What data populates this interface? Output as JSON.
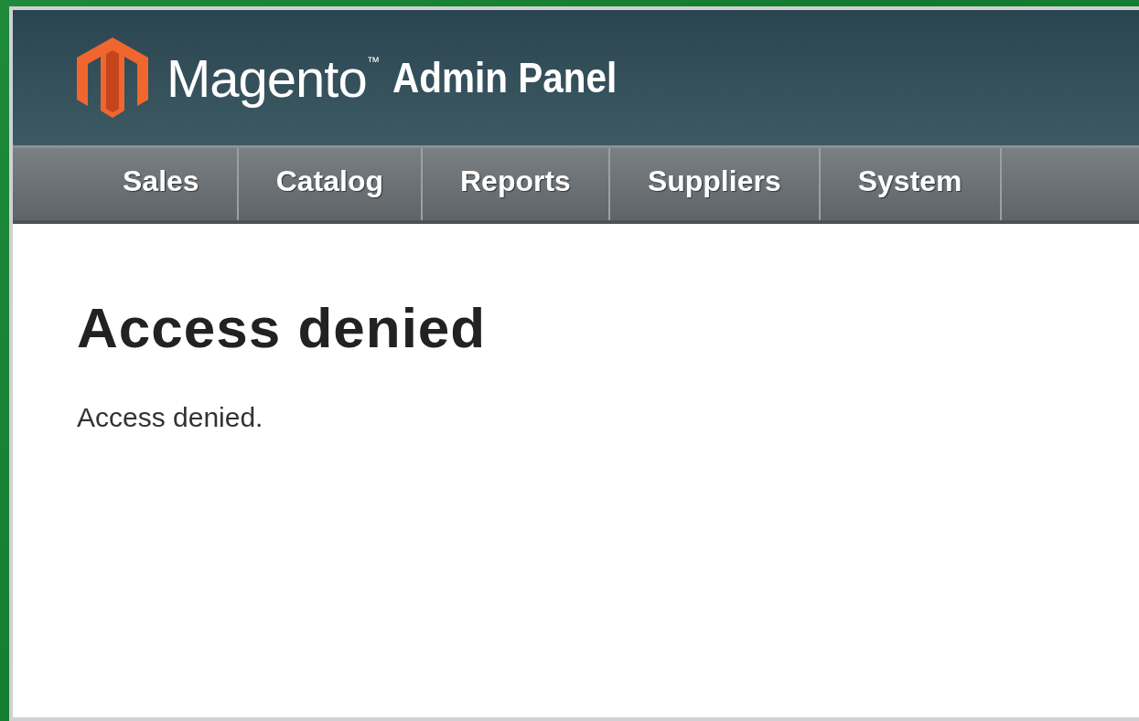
{
  "header": {
    "logo_text": "Magento",
    "trademark": "™",
    "subtitle": "Admin Panel"
  },
  "nav": [
    {
      "label": "Sales"
    },
    {
      "label": "Catalog"
    },
    {
      "label": "Reports"
    },
    {
      "label": "Suppliers"
    },
    {
      "label": "System"
    }
  ],
  "page": {
    "title": "Access denied",
    "message": "Access denied."
  }
}
